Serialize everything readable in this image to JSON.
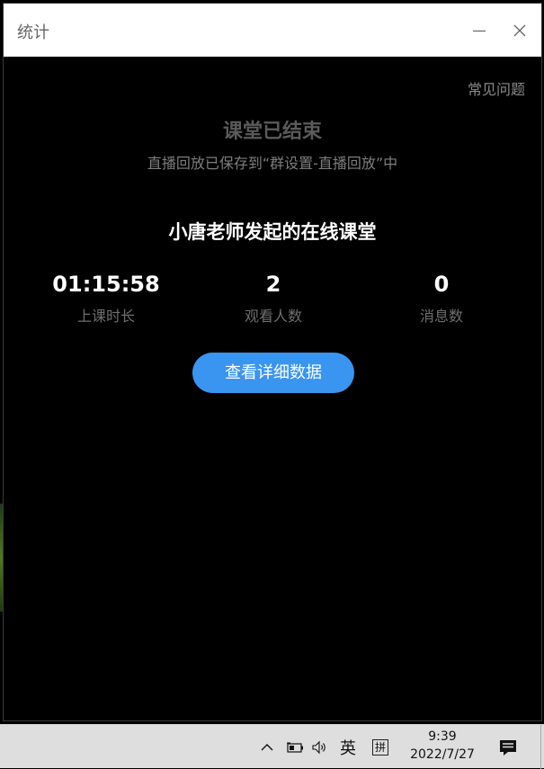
{
  "window": {
    "title": "统计",
    "faq_link": "常见问题"
  },
  "status": {
    "heading": "课堂已结束",
    "note": "直播回放已保存到“群设置-直播回放”中"
  },
  "classroom": {
    "title": "小唐老师发起的在线课堂",
    "stats": [
      {
        "value": "01:15:58",
        "label": "上课时长"
      },
      {
        "value": "2",
        "label": "观看人数"
      },
      {
        "value": "0",
        "label": "消息数"
      }
    ],
    "detail_button": "查看详细数据"
  },
  "taskbar": {
    "language": "英",
    "ime": "拼",
    "time": "9:39",
    "date": "2022/7/27",
    "icons": [
      "chevron-up-icon",
      "battery-icon",
      "volume-icon",
      "notification-icon"
    ]
  },
  "colors": {
    "accent": "#3a95f0",
    "background": "#000000",
    "titlebar": "#ffffff"
  }
}
